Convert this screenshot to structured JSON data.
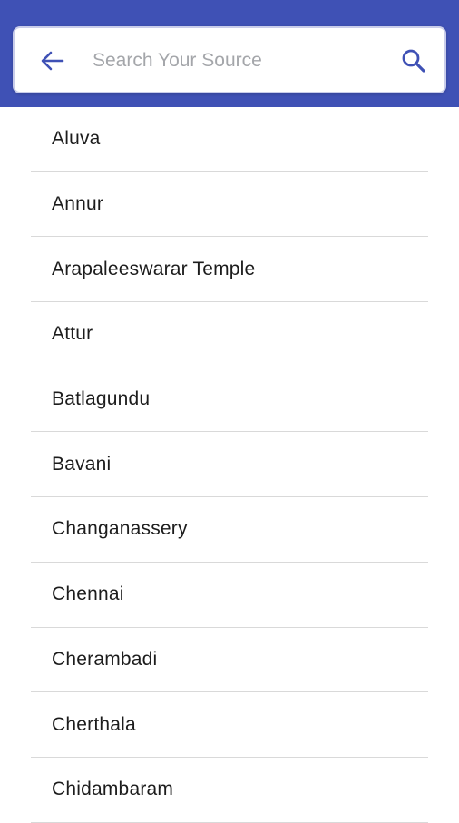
{
  "header": {
    "background_color": "#3f51b5",
    "back_icon": "arrow-left-icon",
    "search_icon": "magnifier-icon",
    "search": {
      "placeholder": "Search Your Source",
      "value": ""
    }
  },
  "sources": [
    {
      "label": "Aluva"
    },
    {
      "label": "Annur"
    },
    {
      "label": "Arapaleeswarar Temple"
    },
    {
      "label": "Attur"
    },
    {
      "label": "Batlagundu"
    },
    {
      "label": "Bavani"
    },
    {
      "label": "Changanassery"
    },
    {
      "label": "Chennai"
    },
    {
      "label": "Cherambadi"
    },
    {
      "label": "Cherthala"
    },
    {
      "label": "Chidambaram"
    }
  ]
}
